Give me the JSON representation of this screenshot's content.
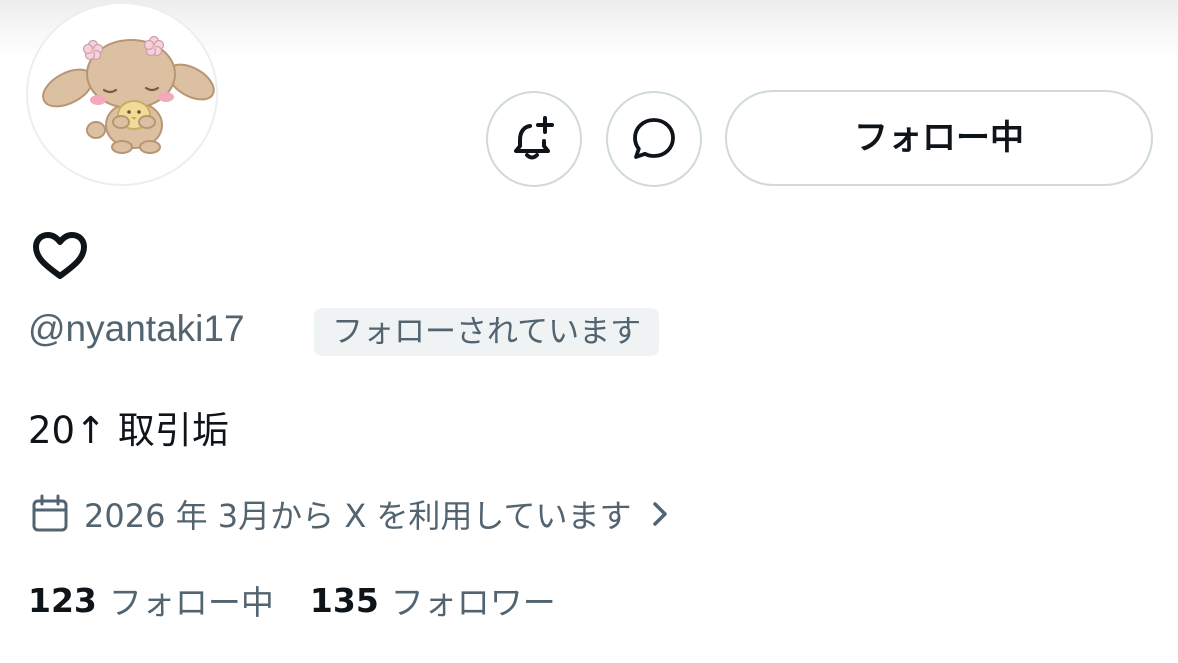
{
  "profile": {
    "display_name_icon": "heart-outline-icon",
    "handle": "@nyantaki17",
    "follows_you_badge": "フォローされています",
    "bio": "20↑ 取引垢",
    "joined": "2026 年 3月から X を利用しています",
    "avatar_icon": "puppy-avatar"
  },
  "actions": {
    "notify_icon": "bell-plus-icon",
    "message_icon": "message-bubble-icon",
    "follow_label": "フォロー中"
  },
  "stats": {
    "following_count": "123",
    "following_label": "フォロー中",
    "followers_count": "135",
    "followers_label": "フォロワー"
  },
  "colors": {
    "text_primary": "#0f1419",
    "text_secondary": "#536471",
    "border": "#cfd9de",
    "badge_bg": "#eff3f4"
  }
}
